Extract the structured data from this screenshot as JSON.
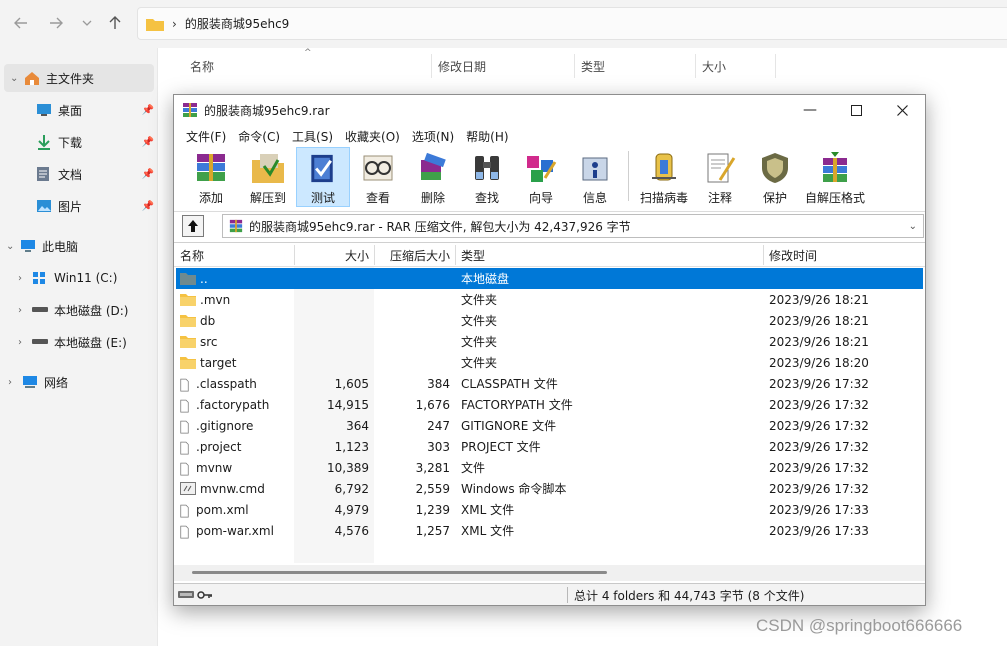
{
  "explorer": {
    "address": "的服装商城95ehc9",
    "columns": [
      "名称",
      "修改日期",
      "类型",
      "大小"
    ],
    "sidebar": {
      "home": "主文件夹",
      "quick": [
        {
          "label": "桌面",
          "icon": "desktop-icon"
        },
        {
          "label": "下载",
          "icon": "download-icon"
        },
        {
          "label": "文档",
          "icon": "document-icon"
        },
        {
          "label": "图片",
          "icon": "picture-icon"
        }
      ],
      "this_pc": "此电脑",
      "drives": [
        "Win11 (C:)",
        "本地磁盘 (D:)",
        "本地磁盘 (E:)"
      ],
      "network": "网络"
    }
  },
  "rar": {
    "title": "的服装商城95ehc9.rar",
    "menu": [
      "文件(F)",
      "命令(C)",
      "工具(S)",
      "收藏夹(O)",
      "选项(N)",
      "帮助(H)"
    ],
    "toolbar": [
      {
        "label": "添加",
        "icon": "add-icon"
      },
      {
        "label": "解压到",
        "icon": "extract-icon"
      },
      {
        "label": "测试",
        "icon": "test-icon"
      },
      {
        "label": "查看",
        "icon": "view-icon"
      },
      {
        "label": "删除",
        "icon": "delete-icon"
      },
      {
        "label": "查找",
        "icon": "find-icon"
      },
      {
        "label": "向导",
        "icon": "wizard-icon"
      },
      {
        "label": "信息",
        "icon": "info-icon"
      },
      {
        "label": "扫描病毒",
        "icon": "virus-scan-icon"
      },
      {
        "label": "注释",
        "icon": "comment-icon"
      },
      {
        "label": "保护",
        "icon": "protect-icon"
      },
      {
        "label": "自解压格式",
        "icon": "sfx-icon"
      }
    ],
    "path": "的服装商城95ehc9.rar - RAR 压缩文件, 解包大小为 42,437,926 字节",
    "columns": [
      "名称",
      "大小",
      "压缩后大小",
      "类型",
      "修改时间"
    ],
    "files": [
      {
        "name": "..",
        "size": "",
        "packed": "",
        "type": "本地磁盘",
        "modified": "",
        "kind": "parent"
      },
      {
        "name": ".mvn",
        "size": "",
        "packed": "",
        "type": "文件夹",
        "modified": "2023/9/26 18:21",
        "kind": "folder"
      },
      {
        "name": "db",
        "size": "",
        "packed": "",
        "type": "文件夹",
        "modified": "2023/9/26 18:21",
        "kind": "folder"
      },
      {
        "name": "src",
        "size": "",
        "packed": "",
        "type": "文件夹",
        "modified": "2023/9/26 18:21",
        "kind": "folder"
      },
      {
        "name": "target",
        "size": "",
        "packed": "",
        "type": "文件夹",
        "modified": "2023/9/26 18:20",
        "kind": "folder"
      },
      {
        "name": ".classpath",
        "size": "1,605",
        "packed": "384",
        "type": "CLASSPATH 文件",
        "modified": "2023/9/26 17:32",
        "kind": "file"
      },
      {
        "name": ".factorypath",
        "size": "14,915",
        "packed": "1,676",
        "type": "FACTORYPATH 文件",
        "modified": "2023/9/26 17:32",
        "kind": "file"
      },
      {
        "name": ".gitignore",
        "size": "364",
        "packed": "247",
        "type": "GITIGNORE 文件",
        "modified": "2023/9/26 17:32",
        "kind": "file"
      },
      {
        "name": ".project",
        "size": "1,123",
        "packed": "303",
        "type": "PROJECT 文件",
        "modified": "2023/9/26 17:32",
        "kind": "file"
      },
      {
        "name": "mvnw",
        "size": "10,389",
        "packed": "3,281",
        "type": "文件",
        "modified": "2023/9/26 17:32",
        "kind": "file"
      },
      {
        "name": "mvnw.cmd",
        "size": "6,792",
        "packed": "2,559",
        "type": "Windows 命令脚本",
        "modified": "2023/9/26 17:32",
        "kind": "script"
      },
      {
        "name": "pom.xml",
        "size": "4,979",
        "packed": "1,239",
        "type": "XML 文件",
        "modified": "2023/9/26 17:33",
        "kind": "file"
      },
      {
        "name": "pom-war.xml",
        "size": "4,576",
        "packed": "1,257",
        "type": "XML 文件",
        "modified": "2023/9/26 17:33",
        "kind": "file"
      }
    ],
    "status": "总计 4 folders 和 44,743 字节 (8 个文件)"
  },
  "watermark": "CSDN @springboot666666",
  "colors": {
    "selection": "#0078d7",
    "folder": "#f5c242",
    "accent": "#cce8ff"
  }
}
